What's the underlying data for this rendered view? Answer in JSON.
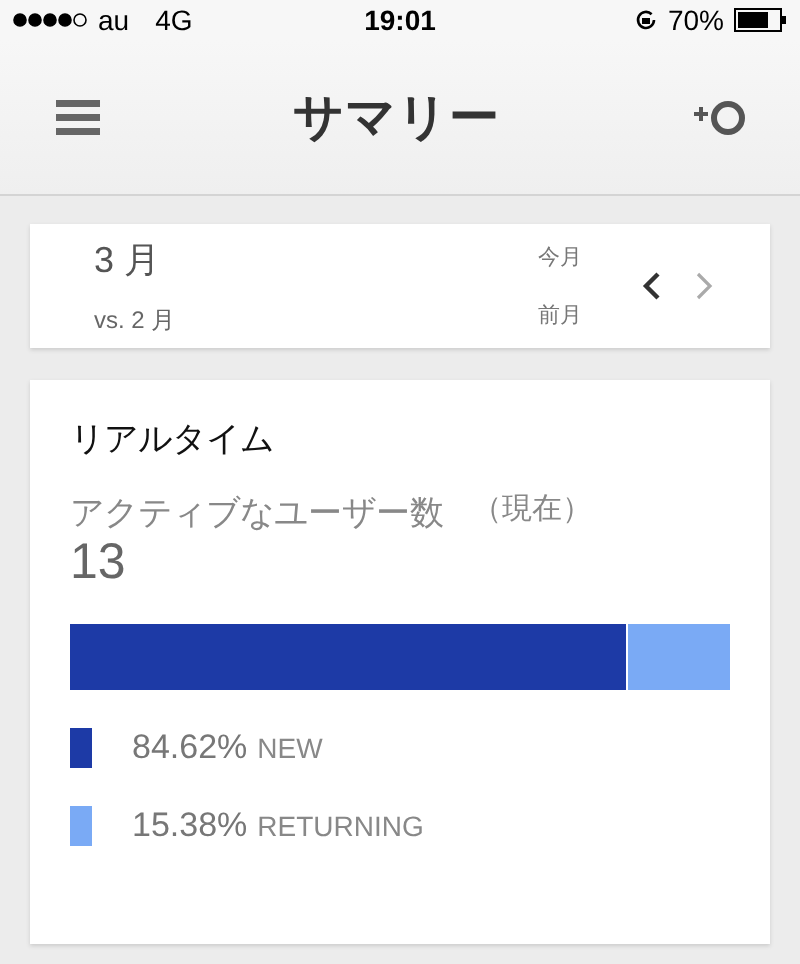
{
  "status_bar": {
    "carrier": "au",
    "network": "4G",
    "time": "19:01",
    "battery": "70%"
  },
  "header": {
    "title": "サマリー"
  },
  "period": {
    "current": "3 月",
    "compare": "vs. 2 月",
    "current_label": "今月",
    "compare_label": "前月"
  },
  "realtime": {
    "title": "リアルタイム",
    "metric": "アクティブなユーザー数",
    "qualifier": "（現在）",
    "value": "13",
    "segments": [
      {
        "percent": "84.62%",
        "label": "NEW",
        "color": "#1d3aa6",
        "level": 0.8462
      },
      {
        "percent": "15.38%",
        "label": "RETURNING",
        "color": "#7aaaf5"
      }
    ]
  }
}
